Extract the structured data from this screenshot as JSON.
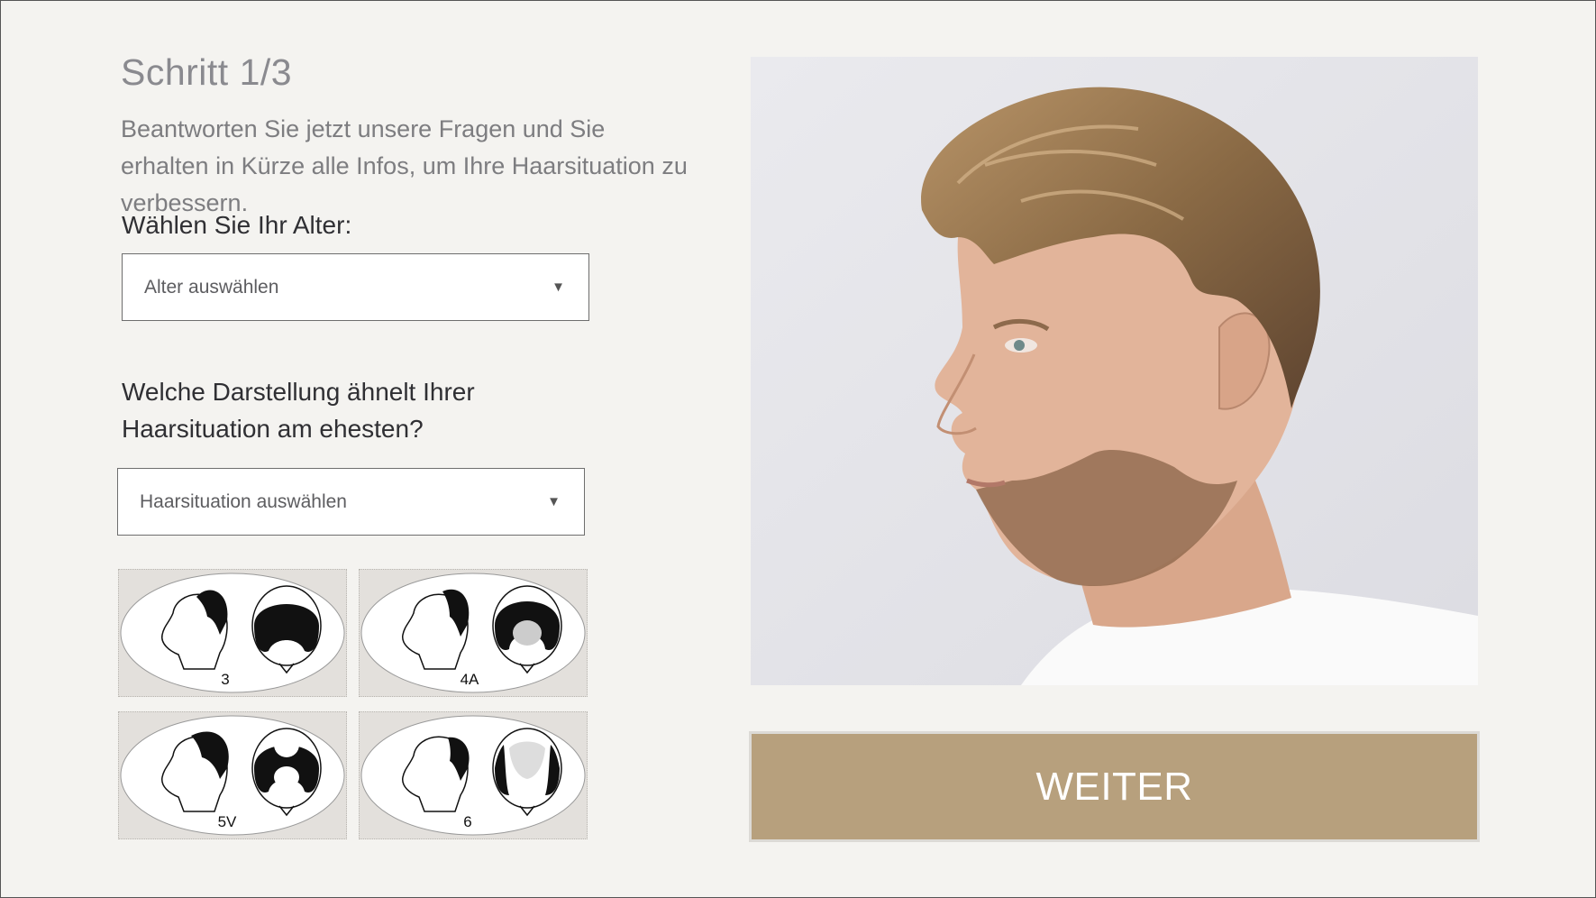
{
  "step": {
    "title": "Schritt 1/3"
  },
  "intro": {
    "text": "Beantworten Sie jetzt unsere Fragen und Sie erhalten in Kürze alle Infos, um Ihre Haarsituation zu verbessern."
  },
  "age": {
    "label": "Wählen Sie Ihr Alter:",
    "placeholder": "Alter auswählen"
  },
  "hair": {
    "label": "Welche Darstellung ähnelt Ihrer Haarsituation am ehesten?",
    "placeholder": "Haarsituation auswählen",
    "options": [
      {
        "code": "3"
      },
      {
        "code": "4A"
      },
      {
        "code": "5V"
      },
      {
        "code": "6"
      }
    ]
  },
  "cta": {
    "label": "WEITER"
  },
  "colors": {
    "accent": "#b7a07d",
    "background": "#f4f3f0"
  },
  "icons": {
    "dropdown": "triangle-down-icon"
  }
}
